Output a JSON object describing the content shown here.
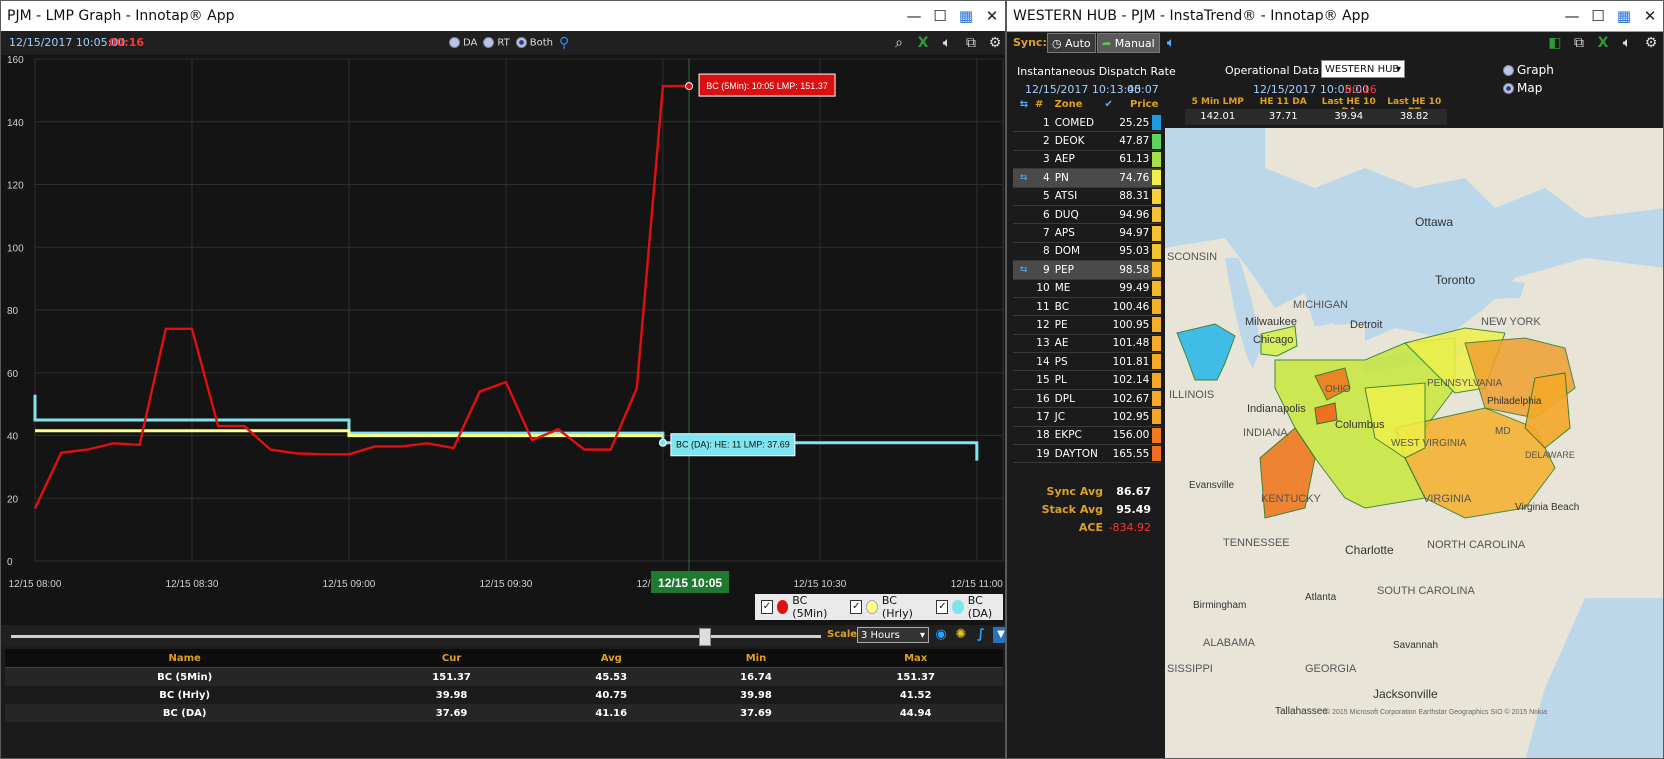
{
  "left": {
    "title": "PJM - LMP Graph - Innotap® App",
    "timestamp": "12/15/2017 10:05:00",
    "countdown": "00:16",
    "modes": [
      "DA",
      "RT",
      "Both"
    ],
    "selected_mode": "Both",
    "legend": [
      {
        "label": "BC (5Min)",
        "color": "#e01010"
      },
      {
        "label": "BC (Hrly)",
        "color": "#ffff88"
      },
      {
        "label": "BC (DA)",
        "color": "#7fe4f0"
      }
    ],
    "scale_label": "Scale:",
    "scale_value": "3 Hours",
    "cursor_label": "12/15 10:05",
    "tooltip_rt": "BC (5Min): 10:05 LMP: 151.37",
    "tooltip_da": "BC (DA): HE: 11 LMP: 37.69",
    "stats": {
      "headers": [
        "Name",
        "Cur",
        "Avg",
        "Min",
        "Max"
      ],
      "rows": [
        [
          "BC (5Min)",
          "151.37",
          "45.53",
          "16.74",
          "151.37"
        ],
        [
          "BC (Hrly)",
          "39.98",
          "40.75",
          "39.98",
          "41.52"
        ],
        [
          "BC (DA)",
          "37.69",
          "41.16",
          "37.69",
          "44.94"
        ]
      ]
    }
  },
  "chart_data": {
    "type": "line",
    "ylim": [
      0,
      160
    ],
    "yticks": [
      "0",
      "20",
      "40",
      "60",
      "80",
      "100",
      "120",
      "140",
      "160"
    ],
    "xticks": [
      "12/15 08:00",
      "12/15 08:30",
      "12/15 09:00",
      "12/15 09:30",
      "12/15 10:00",
      "12/15 10:30",
      "12/15 11:00"
    ],
    "xlim_minutes": [
      0,
      185
    ],
    "series": [
      {
        "name": "BC (5Min)",
        "color": "#e01010",
        "x": [
          0,
          5,
          10,
          15,
          20,
          25,
          30,
          35,
          40,
          45,
          50,
          55,
          60,
          65,
          70,
          75,
          80,
          85,
          90,
          95,
          100,
          105,
          110,
          115,
          120,
          125
        ],
        "y": [
          16.74,
          34.5,
          35.5,
          37.5,
          37,
          74,
          74,
          43,
          43,
          35.5,
          34.3,
          34,
          34,
          36.5,
          36.5,
          37.5,
          36,
          54,
          57,
          38.5,
          42,
          35.5,
          35.5,
          55,
          151.37,
          151.37
        ]
      },
      {
        "name": "BC (Hrly)",
        "color": "#ffff88",
        "step": true,
        "x": [
          0,
          60,
          60,
          120
        ],
        "y": [
          41.52,
          41.52,
          39.98,
          39.98
        ]
      },
      {
        "name": "BC (DA)",
        "color": "#7fe4f0",
        "step": true,
        "x": [
          0,
          0,
          60,
          60,
          120,
          120,
          180,
          180
        ],
        "y": [
          53,
          44.94,
          44.94,
          40.75,
          40.75,
          37.69,
          37.69,
          32
        ]
      }
    ]
  },
  "right": {
    "title": "WESTERN HUB - PJM - InstaTrend® - Innotap® App",
    "sync_label": "Sync:",
    "auto_label": "Auto",
    "manual_label": "Manual",
    "idr_label": "Instantaneous Dispatch Rate",
    "idr_time": "12/15/2017 10:13:45",
    "idr_countdown": "00:07",
    "op_label": "Operational Data",
    "op_select": "WESTERN HUB",
    "op_time": "12/15/2017 10:05:00",
    "op_countdown": "00:16",
    "graph_label": "Graph",
    "map_label": "Map",
    "op_headers": [
      "5 Min LMP",
      "HE 11 DA",
      "Last HE 10 DA",
      "Last HE 10 RT"
    ],
    "op_values": [
      "142.01",
      "37.71",
      "39.94",
      "38.82"
    ],
    "zone_headers": {
      "num": "#",
      "zone": "Zone",
      "price": "Price"
    },
    "zones": [
      {
        "n": "1",
        "name": "COMED",
        "price": "25.25",
        "color": "#1e9be0",
        "arrow": false
      },
      {
        "n": "2",
        "name": "DEOK",
        "price": "47.87",
        "color": "#5ed35e",
        "arrow": false
      },
      {
        "n": "3",
        "name": "AEP",
        "price": "61.13",
        "color": "#a8e04a",
        "arrow": false
      },
      {
        "n": "4",
        "name": "PN",
        "price": "74.76",
        "color": "#eef04a",
        "arrow": true
      },
      {
        "n": "5",
        "name": "ATSI",
        "price": "88.31",
        "color": "#f5d23a",
        "arrow": false
      },
      {
        "n": "6",
        "name": "DUQ",
        "price": "94.96",
        "color": "#f5c230",
        "arrow": false
      },
      {
        "n": "7",
        "name": "APS",
        "price": "94.97",
        "color": "#f5c230",
        "arrow": false
      },
      {
        "n": "8",
        "name": "DOM",
        "price": "95.03",
        "color": "#f5c230",
        "arrow": false
      },
      {
        "n": "9",
        "name": "PEP",
        "price": "98.58",
        "color": "#f5b82c",
        "arrow": true
      },
      {
        "n": "10",
        "name": "ME",
        "price": "99.49",
        "color": "#f5b82c",
        "arrow": false
      },
      {
        "n": "11",
        "name": "BC",
        "price": "100.46",
        "color": "#f5b02a",
        "arrow": false
      },
      {
        "n": "12",
        "name": "PE",
        "price": "100.95",
        "color": "#f5b02a",
        "arrow": false
      },
      {
        "n": "13",
        "name": "AE",
        "price": "101.48",
        "color": "#f5aa2a",
        "arrow": false
      },
      {
        "n": "14",
        "name": "PS",
        "price": "101.81",
        "color": "#f5aa2a",
        "arrow": false
      },
      {
        "n": "15",
        "name": "PL",
        "price": "102.14",
        "color": "#f5a82a",
        "arrow": false
      },
      {
        "n": "16",
        "name": "DPL",
        "price": "102.67",
        "color": "#f5a82a",
        "arrow": false
      },
      {
        "n": "17",
        "name": "JC",
        "price": "102.95",
        "color": "#f5a62a",
        "arrow": false
      },
      {
        "n": "18",
        "name": "EKPC",
        "price": "156.00",
        "color": "#ef7a20",
        "arrow": false
      },
      {
        "n": "19",
        "name": "DAYTON",
        "price": "165.55",
        "color": "#ef7020",
        "arrow": false
      }
    ],
    "sync_avg_label": "Sync Avg",
    "sync_avg": "86.67",
    "stack_avg_label": "Stack Avg",
    "stack_avg": "95.49",
    "ace_label": "ACE",
    "ace": "-834.92",
    "map_labels": [
      "Ottawa",
      "Toronto",
      "MICHIGAN",
      "NEW YORK",
      "Milwaukee",
      "Detroit",
      "Chicago",
      "OHIO",
      "PENNSYLVANIA",
      "Philadelphia",
      "ILLINOIS",
      "Indianapolis",
      "INDIANA",
      "Columbus",
      "WEST VIRGINIA",
      "MD",
      "DELAWARE",
      "Evansville",
      "KENTUCKY",
      "VIRGINIA",
      "Virginia Beach",
      "TENNESSEE",
      "Charlotte",
      "NORTH CAROLINA",
      "SOUTH CAROLINA",
      "Birmingham",
      "Atlanta",
      "ALABAMA",
      "GEORGIA",
      "Savannah",
      "Jacksonville",
      "Tallahassee",
      "SCONSIN",
      "SISSIPPI"
    ],
    "map_credit": "© 2015 Microsoft Corporation  Earthstar Geographics SIO © 2015 Nokia"
  }
}
